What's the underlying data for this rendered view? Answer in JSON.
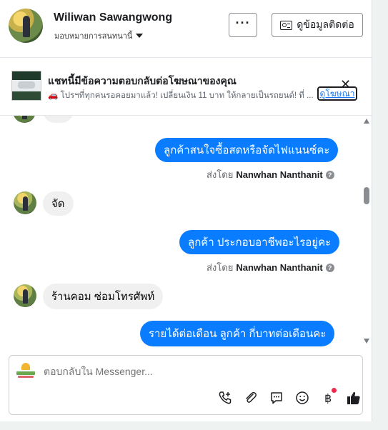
{
  "header": {
    "contact_name": "Wiliwan Sawangwong",
    "assign_label": "มอบหมายการสนทนานี้",
    "more_label": "···",
    "contact_info_label": "ดูข้อมูลติดต่อ"
  },
  "ad_banner": {
    "title": "แชทนี้มีข้อความตอบกลับต่อโฆษณาของคุณ",
    "subtitle": "🚗 โปรฯที่ทุกคนรอคอยมาแล้ว! เปลี่ยนเงิน 11 บาท ให้กลายเป็นรถยนต์! ที่ ...",
    "link_label": "ดูโฆษณา",
    "close_label": "✕"
  },
  "messages": [
    {
      "direction": "in",
      "text": "จัด"
    },
    {
      "direction": "out",
      "text": "ลูกค้าสนใจซื้อสดหรือจัดไฟแนนซ์คะ"
    },
    {
      "direction": "in",
      "text": "จัด"
    },
    {
      "direction": "out",
      "text": "ลูกค้า ประกอบอาชีพอะไรอยู่คะ"
    },
    {
      "direction": "in",
      "text": "ร้านคอม ซ่อมโทรศัพท์"
    },
    {
      "direction": "out",
      "text": "รายได้ต่อเดือน ลูกค้า  กี่บาทต่อเดือนคะ"
    }
  ],
  "sent_by": {
    "prefix": "ส่งโดย",
    "agent_name": "Nanwhan Nanthanit",
    "help": "?"
  },
  "composer": {
    "placeholder": "ตอบกลับใน Messenger..."
  },
  "toolbar_icons": [
    "add-call-icon",
    "attachment-icon",
    "saved-replies-icon",
    "emoji-icon",
    "baht-payment-icon",
    "like-icon"
  ],
  "colors": {
    "outgoing_bubble": "#0a7cff",
    "incoming_bubble": "#f0f0f0",
    "link": "#1877f2",
    "notification_dot": "#f02849"
  }
}
